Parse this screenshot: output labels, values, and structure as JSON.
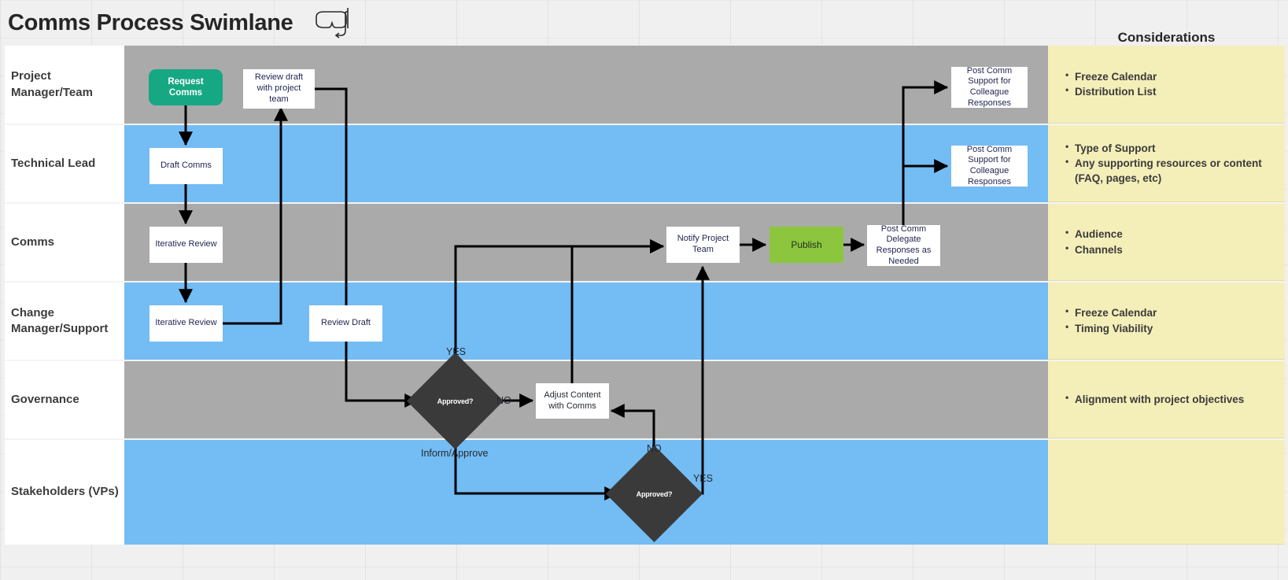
{
  "header": {
    "title": "Comms Process Swimlane",
    "icon": "snorkel-mask-icon",
    "considerations_title": "Considerations"
  },
  "colors": {
    "lane_gray": "#aaaaaa",
    "lane_blue": "#74bcf4",
    "considerations_bg": "#f4efb9",
    "start_node": "#16a883",
    "publish_node": "#8cc63f",
    "decision_node": "#3a3a3a",
    "page_bg": "#f0f0f0"
  },
  "lanes": [
    {
      "id": "project-manager-team",
      "label": "Project Manager/Team",
      "band": "gray",
      "considerations": [
        "Freeze Calendar",
        "Distribution List"
      ]
    },
    {
      "id": "technical-lead",
      "label": "Technical Lead",
      "band": "blue",
      "considerations": [
        "Type of Support",
        "Any supporting resources or content (FAQ, pages, etc)"
      ]
    },
    {
      "id": "comms",
      "label": "Comms",
      "band": "gray",
      "considerations": [
        "Audience",
        "Channels"
      ]
    },
    {
      "id": "change-manager-support",
      "label": "Change Manager/Support",
      "band": "blue",
      "considerations": [
        "Freeze Calendar",
        "Timing Viability"
      ]
    },
    {
      "id": "governance",
      "label": "Governance",
      "band": "gray",
      "considerations": [
        "Alignment with project objectives"
      ]
    },
    {
      "id": "stakeholders-vps",
      "label": "Stakeholders (VPs)",
      "band": "blue",
      "considerations": []
    }
  ],
  "nodes": {
    "request_comms": "Request Comms",
    "review_draft_with_project_team": "Review draft with project team",
    "post_comm_support_pm": "Post Comm Support for Colleague Responses",
    "draft_comms": "Draft Comms",
    "post_comm_support_tech": "Post Comm Support for Colleague Responses",
    "iterative_review_comms": "Iterative Review",
    "notify_project_team": "Notify Project Team",
    "publish": "Publish",
    "post_comm_delegate": "Post Comm Delegate Responses as Needed",
    "iterative_review_change": "Iterative Review",
    "review_draft": "Review Draft",
    "approved_governance": "Approved?",
    "adjust_content_with_comms": "Adjust Content with Comms",
    "approved_stakeholders": "Approved?"
  },
  "edge_labels": {
    "yes_governance": "YES",
    "no_governance": "NO",
    "inform_approve": "Inform/Approve",
    "no_stakeholders": "NO",
    "yes_stakeholders": "YES"
  }
}
